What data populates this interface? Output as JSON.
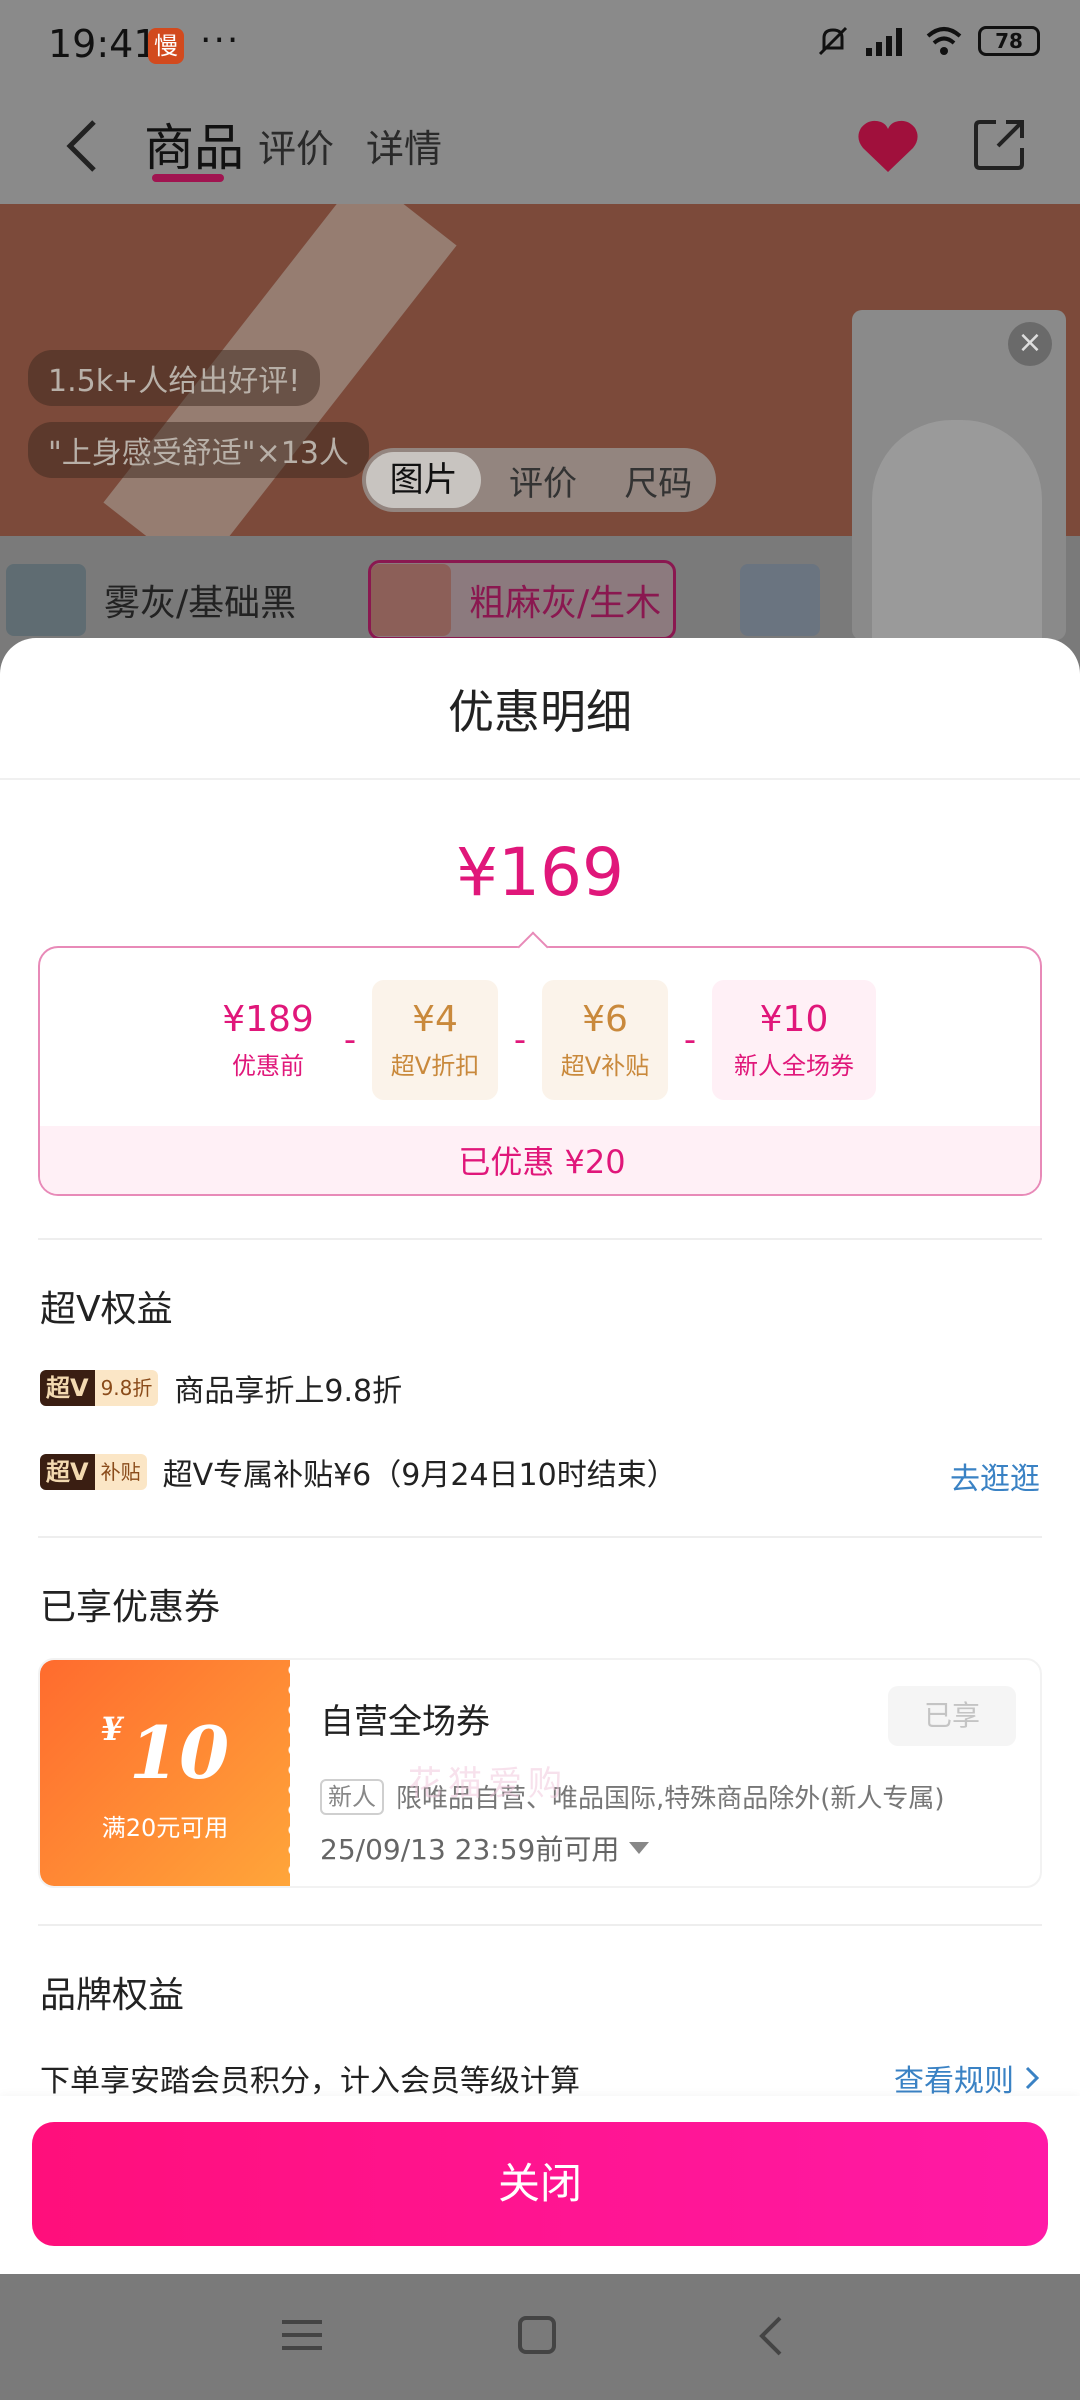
{
  "status_bar": {
    "time": "19:41",
    "app_icon_text": "慢",
    "more": "···",
    "battery": "78",
    "icons": [
      "mute-icon",
      "signal-icon",
      "wifi-icon",
      "battery-icon"
    ]
  },
  "nav": {
    "tabs": [
      "商品",
      "评价",
      "详情"
    ],
    "active_tab": "商品",
    "icons": [
      "back-icon",
      "heart-icon",
      "share-icon"
    ],
    "accent_color": "#a01450"
  },
  "hero": {
    "pills": [
      "1.5k+人给出好评!",
      "\"上身感受舒适\"×13人"
    ],
    "switch": [
      "图片",
      "评价",
      "尺码"
    ],
    "switch_active": "图片"
  },
  "colors": [
    {
      "label": "雾灰/基础黑",
      "selected": false
    },
    {
      "label": "粗麻灰/生木",
      "selected": true
    }
  ],
  "sheet": {
    "title": "优惠明细",
    "final_price": "¥169",
    "breakdown": [
      {
        "amount": "¥189",
        "label": "优惠前",
        "kind": "base"
      },
      {
        "amount": "¥4",
        "label": "超V折扣",
        "kind": "vip"
      },
      {
        "amount": "¥6",
        "label": "超V补贴",
        "kind": "vip"
      },
      {
        "amount": "¥10",
        "label": "新人全场券",
        "kind": "coupon"
      }
    ],
    "minus_sign": "-",
    "saved": "已优惠 ¥20",
    "watermark": "花猫爱购"
  },
  "super_v": {
    "title": "超V权益",
    "items": [
      {
        "tag_v": "超V",
        "tag_text": "9.8折",
        "text": "商品享折上9.8折",
        "link": ""
      },
      {
        "tag_v": "超V",
        "tag_text": "补贴",
        "text": "超V专属补贴¥6（9月24日10时结束）",
        "link": "去逛逛"
      }
    ]
  },
  "coupons": {
    "title": "已享优惠券",
    "card": {
      "yen": "¥",
      "amount": "10",
      "condition": "满20元可用",
      "name": "自营全场券",
      "status": "已享",
      "new_tag": "新人",
      "description": "限唯品自营、唯品国际,特殊商品除外(新人专属)",
      "expire": "25/09/13 23:59前可用"
    }
  },
  "brand": {
    "title": "品牌权益",
    "text": "下单享安踏会员积分，计入会员等级计算",
    "link": "查看规则"
  },
  "close_button": "关闭",
  "brand_colors": {
    "primary": "#e0177a",
    "vip_gold": "#c9893c",
    "link": "#3a82c4"
  }
}
